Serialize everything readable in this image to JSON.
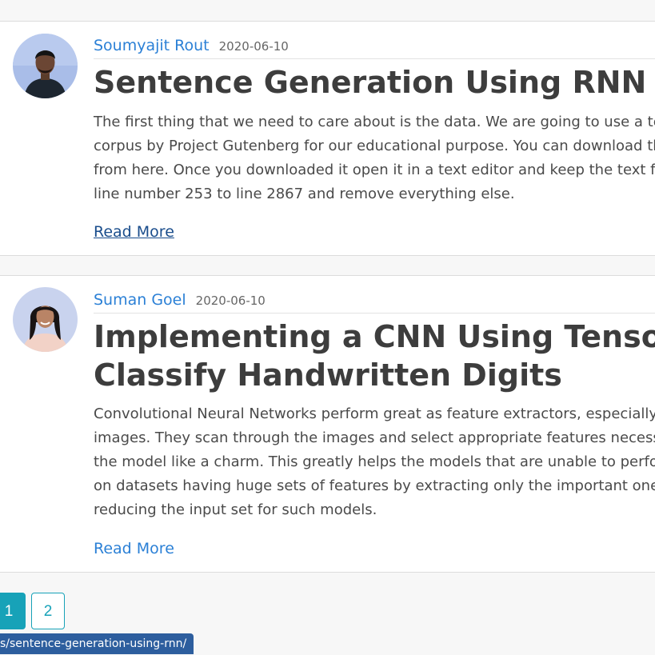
{
  "posts": [
    {
      "author": "Soumyajit Rout",
      "date": "2020-06-10",
      "title": "Sentence Generation Using RNN",
      "excerpt_lines": [
        "The first thing that we need to care about is the data. We are going to use a text",
        "corpus by Project Gutenberg for our educational purpose. You can download the",
        "from here. Once you downloaded it open it in a text editor and keep the text fro",
        "line number 253 to line 2867 and remove everything else."
      ],
      "read_more": "Read More"
    },
    {
      "author": "Suman Goel",
      "date": "2020-06-10",
      "title_lines": [
        "Implementing a CNN Using Tensorflow",
        "Classify Handwritten Digits"
      ],
      "excerpt_lines": [
        "Convolutional Neural Networks perform great as feature extractors, especially in",
        "images. They scan through the images and select appropriate features necessary",
        "the model like a charm. This greatly helps the models that are unable to perform",
        "on datasets having huge sets of features by extracting only the important ones a",
        "reducing the input set for such models."
      ],
      "read_more": "Read More"
    }
  ],
  "pagination": {
    "pages": [
      "1",
      "2"
    ],
    "current": "1"
  },
  "status_url": "s/sentence-generation-using-rnn/",
  "colors": {
    "link": "#2b80d6",
    "visited_link": "#1a4d8c",
    "pagination_accent": "#17a2b8",
    "status_bar": "#2d5e9e"
  },
  "icons": {
    "avatar_1": "male-author-avatar",
    "avatar_2": "female-author-avatar"
  }
}
